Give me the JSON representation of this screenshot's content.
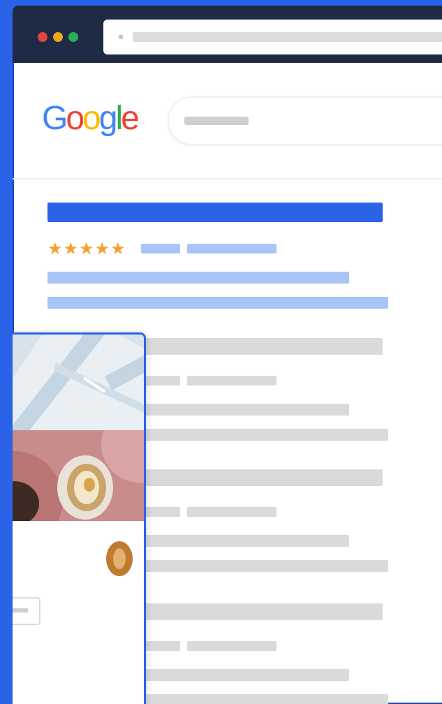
{
  "browser": {
    "traffic_lights": [
      "#e2473b",
      "#f0a61b",
      "#27b05a"
    ]
  },
  "google": {
    "logo_letters": [
      {
        "ch": "G",
        "color": "#4285F4"
      },
      {
        "ch": "o",
        "color": "#EA4335"
      },
      {
        "ch": "o",
        "color": "#FBBC05"
      },
      {
        "ch": "g",
        "color": "#4285F4"
      },
      {
        "ch": "l",
        "color": "#34A853"
      },
      {
        "ch": "e",
        "color": "#EA4335"
      }
    ]
  },
  "featured_result": {
    "stars": "★★★★★",
    "star_color": "#f2a22b",
    "rating_fraction": 1.0
  },
  "colors": {
    "accent_blue": "#2a63e8",
    "result_light_blue": "#a9c4f6",
    "placeholder_gray": "#dadada"
  },
  "icons": [
    "map-thumbnail",
    "food-photo",
    "rating-star"
  ]
}
